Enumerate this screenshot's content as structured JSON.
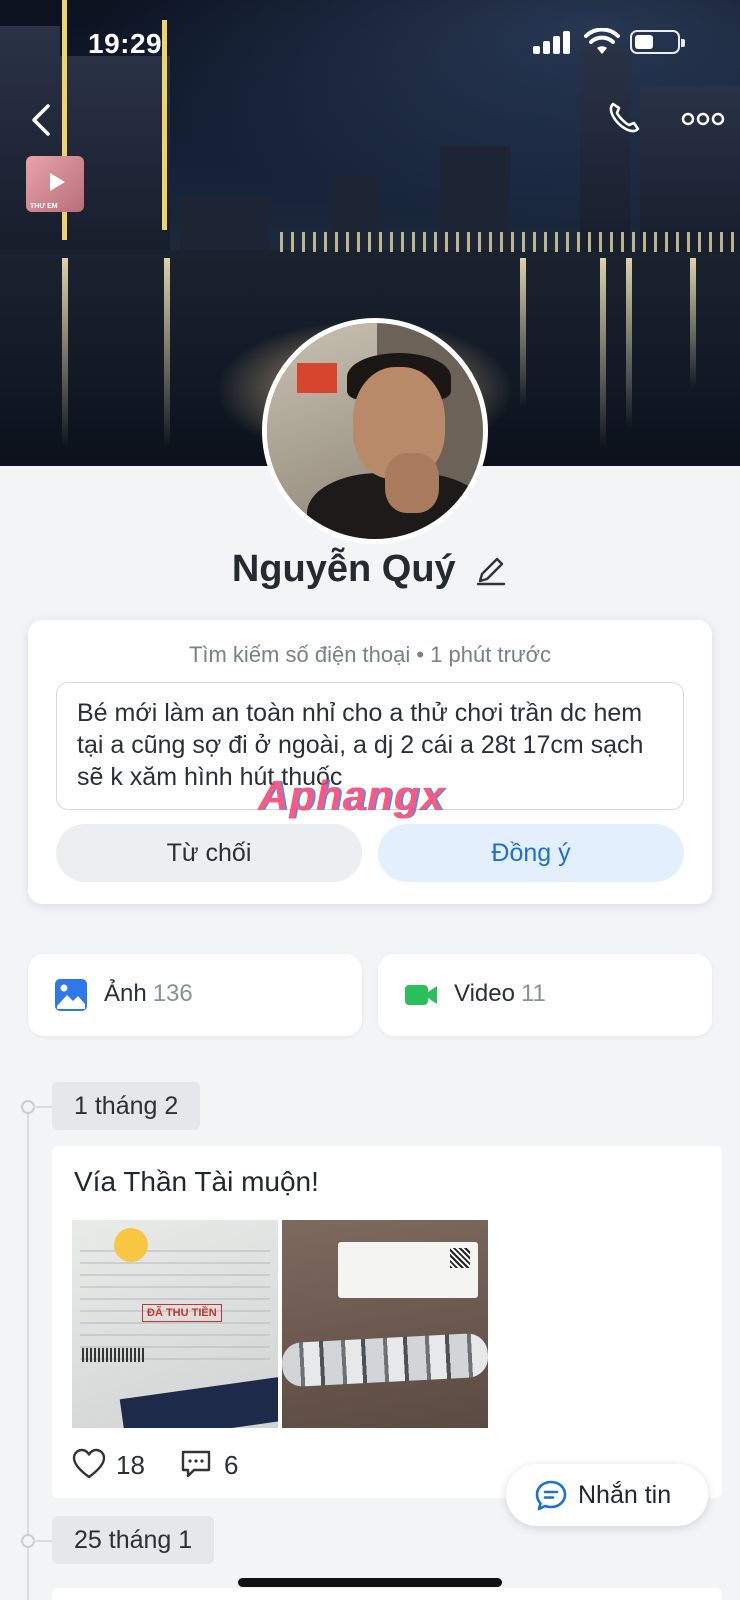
{
  "status_bar": {
    "time": "19:29"
  },
  "header": {
    "back_icon": "chevron-left-icon",
    "call_icon": "phone-icon",
    "more_icon": "more-horizontal-icon",
    "music_caption": "THƯ EM"
  },
  "profile": {
    "name": "Nguyễn Quý"
  },
  "friend_request": {
    "meta": "Tìm kiếm số điện thoại • 1 phút trước",
    "message": "Bé mới làm an toàn nhỉ cho a thử chơi trần dc hem tại a cũng sợ đi ở ngoài, a dj 2 cái a 28t 17cm sạch sẽ k xăm hình hút thuốc",
    "decline_label": "Từ chối",
    "accept_label": "Đồng ý",
    "accent_color": "#1d6fd1"
  },
  "watermark": "Aphangx",
  "media": {
    "photo": {
      "label": "Ảnh",
      "count": "136",
      "icon": "image-icon"
    },
    "video": {
      "label": "Video",
      "count": "11",
      "icon": "video-camera-icon"
    }
  },
  "timeline": [
    {
      "date": "1 tháng 2",
      "text": "Vía Thần Tài muộn!",
      "stamp_text": "ĐÃ THU TIỀN",
      "likes": "18",
      "comments": "6"
    },
    {
      "date": "25 tháng 1"
    }
  ],
  "fab": {
    "label": "Nhắn tin",
    "icon": "chat-bubble-icon"
  }
}
